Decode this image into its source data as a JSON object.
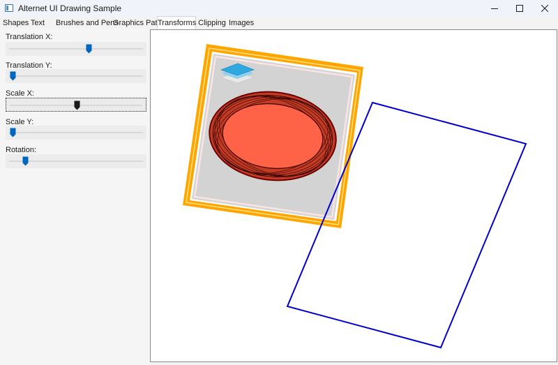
{
  "window": {
    "title": "Alternet UI Drawing Sample",
    "icon": "app-window-icon",
    "controls": [
      "minimize-icon",
      "maximize-icon",
      "close-icon"
    ]
  },
  "tabs": [
    {
      "label": "Shapes",
      "active": false
    },
    {
      "label": "Text",
      "active": false
    },
    {
      "label": "Brushes and Pens",
      "active": false
    },
    {
      "label": "Graphics Path",
      "active": false
    },
    {
      "label": "Transforms",
      "active": true
    },
    {
      "label": "Clipping",
      "active": false
    },
    {
      "label": "Images",
      "active": false
    }
  ],
  "sliders": [
    {
      "label": "Translation X:",
      "value": 0.6,
      "focused": false
    },
    {
      "label": "Translation Y:",
      "value": 0.0,
      "focused": false
    },
    {
      "label": "Scale X:",
      "value": 0.5,
      "focused": true
    },
    {
      "label": "Scale Y:",
      "value": 0.0,
      "focused": false
    },
    {
      "label": "Rotation:",
      "value": 0.1,
      "focused": false
    }
  ],
  "colors": {
    "thumb": "#0067c0",
    "thumb_focused": "#1a1a1a",
    "frame_gold": "#ffa500",
    "frame_gray": "#d3d3d3",
    "ellipse_fill": "#ff6347",
    "ellipse_stroke": "#8b0000",
    "rect_outline": "#0000cd"
  }
}
